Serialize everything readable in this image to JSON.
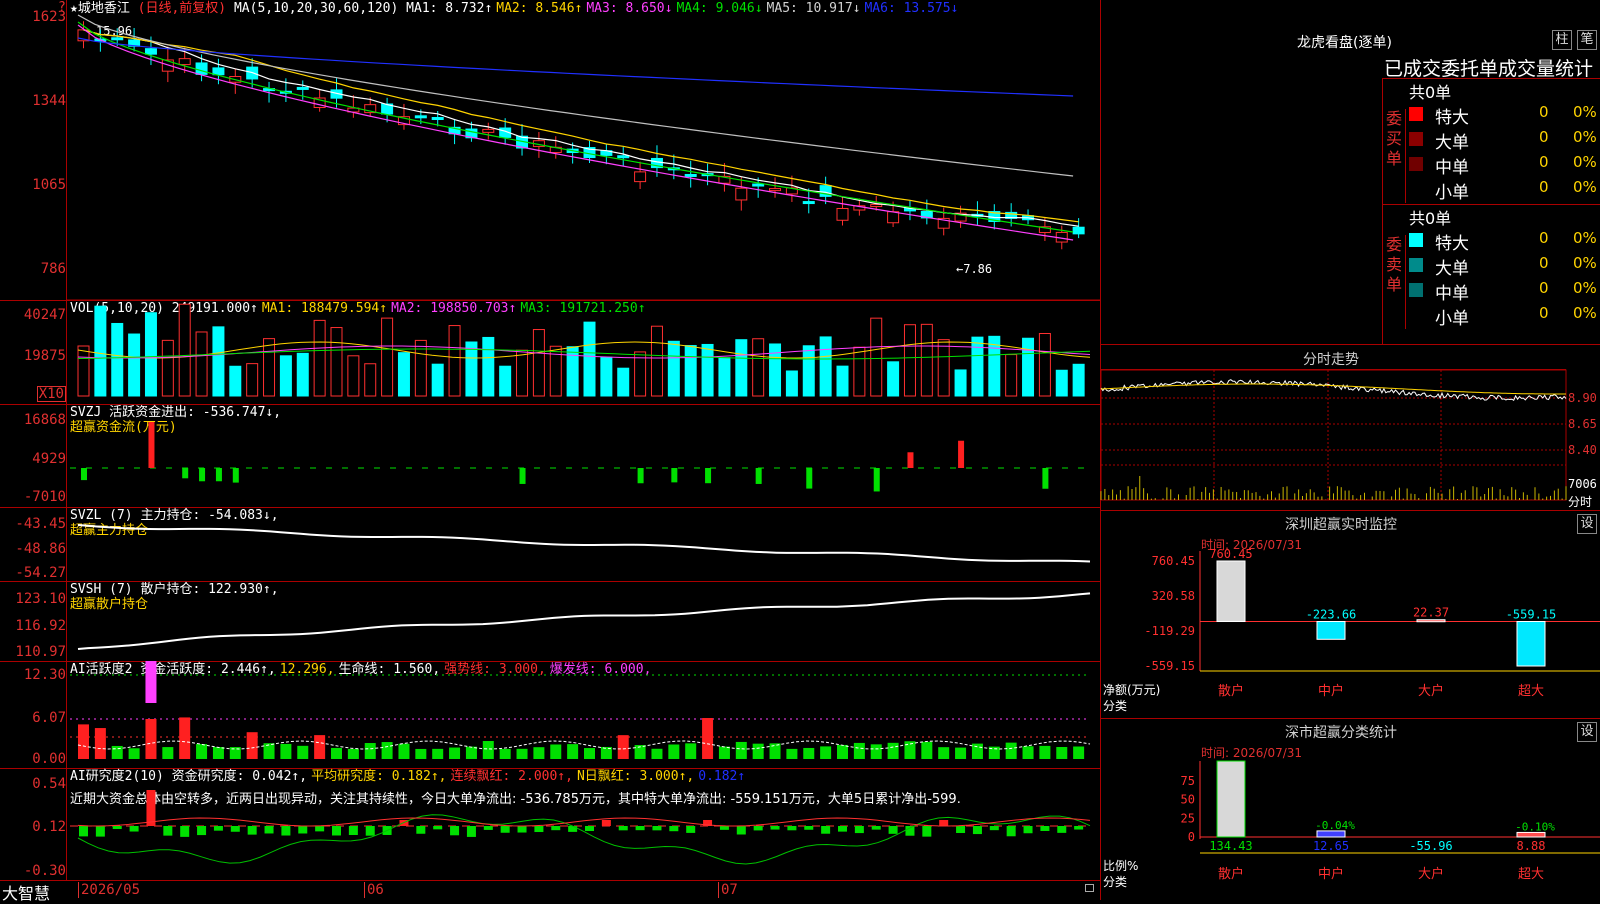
{
  "stock": {
    "title": "★城地香江",
    "mode": "(日线,前复权)",
    "ma_label": "MA(5,10,20,30,60,120)",
    "ma": [
      {
        "text": "MA1: 8.732↑",
        "color": "#ffffff"
      },
      {
        "text": "MA2: 8.546↑",
        "color": "#ffd400"
      },
      {
        "text": "MA3: 8.650↓",
        "color": "#ff40ff"
      },
      {
        "text": "MA4: 9.046↓",
        "color": "#00e000"
      },
      {
        "text": "MA5: 10.917↓",
        "color": "#d0d0d0"
      },
      {
        "text": "MA6: 13.575↓",
        "color": "#2030ff"
      }
    ],
    "high_note": "15.96",
    "low_note": "←7.86",
    "yaxis": [
      "1623",
      "1344",
      "1065",
      "786"
    ]
  },
  "vol": {
    "label": "VOL(5,10,20)",
    "items": [
      {
        "text": "249191.000↑",
        "color": "#ffffff"
      },
      {
        "text": "MA1: 188479.594↑",
        "color": "#ffd400"
      },
      {
        "text": "MA2: 198850.703↑",
        "color": "#ff40ff"
      },
      {
        "text": "MA3: 191721.250↑",
        "color": "#00e000"
      }
    ],
    "yaxis": [
      "40247",
      "19875"
    ],
    "unit": "X10"
  },
  "svzj": {
    "label": "SVZJ  活跃资金进出: -536.747↓,",
    "sub": "超赢资金流(万元)",
    "yaxis": [
      "16868",
      "4929",
      "-7010"
    ]
  },
  "svzl": {
    "label": "SVZL (7) 主力持仓: -54.083↓,",
    "sub": "超赢主力持仓",
    "yaxis": [
      "-43.45",
      "-48.86",
      "-54.27"
    ]
  },
  "svsh": {
    "label": "SVSH (7) 散户持仓: 122.930↑,",
    "sub": "超赢散户持仓",
    "yaxis": [
      "123.10",
      "116.92",
      "110.97"
    ]
  },
  "ai1": {
    "items": [
      {
        "text": "AI活跃度2 资金活跃度: 2.446↑,",
        "color": "#ffffff"
      },
      {
        "text": "12.296,",
        "color": "#ffd400"
      },
      {
        "text": "生命线: 1.560,",
        "color": "#ffffff"
      },
      {
        "text": "强势线: 3.000,",
        "color": "#ff3030"
      },
      {
        "text": "爆发线: 6.000,",
        "color": "#ff40ff"
      }
    ],
    "yaxis": [
      "12.30",
      "6.07",
      "0.00"
    ]
  },
  "ai2": {
    "items": [
      {
        "text": "AI研究度2(10) 资金研究度: 0.042↑,",
        "color": "#ffffff"
      },
      {
        "text": "平均研究度: 0.182↑,",
        "color": "#ffd400"
      },
      {
        "text": "连续飘红: 2.000↑,",
        "color": "#ff3030"
      },
      {
        "text": "N日飘红: 3.000↑,",
        "color": "#ffd400"
      },
      {
        "text": "0.182↑",
        "color": "#2030ff"
      }
    ],
    "note": "近期大资金总体由空转多，近两日出现异动，关注其持续性，今日大单净流出: -536.785万元，其中特大单净流出: -559.151万元，大单5日累计净出-599.",
    "yaxis": [
      "0.54",
      "0.12",
      "-0.30"
    ]
  },
  "xaxis": {
    "d1": "2026/05",
    "d2": "06",
    "d3": "07"
  },
  "brand": "大智慧",
  "lhb": {
    "title": "龙虎看盘(逐单)",
    "btn1": "柱",
    "btn2": "笔",
    "headline": "已成交委托单成交量统计",
    "buy": {
      "count": "共0单",
      "side": "委买单",
      "rows": [
        {
          "label": "特大",
          "v": "0",
          "p": "0%",
          "color": "#ff0000"
        },
        {
          "label": "大单",
          "v": "0",
          "p": "0%",
          "color": "#8b0000"
        },
        {
          "label": "中单",
          "v": "0",
          "p": "0%",
          "color": "#700000"
        },
        {
          "label": "小单",
          "v": "0",
          "p": "0%",
          "color": ""
        }
      ]
    },
    "sell": {
      "count": "共0单",
      "side": "委卖单",
      "rows": [
        {
          "label": "特大",
          "v": "0",
          "p": "0%",
          "color": "#00ffff"
        },
        {
          "label": "大单",
          "v": "0",
          "p": "0%",
          "color": "#008b8b"
        },
        {
          "label": "中单",
          "v": "0",
          "p": "0%",
          "color": "#007070"
        },
        {
          "label": "小单",
          "v": "0",
          "p": "0%",
          "color": ""
        }
      ]
    }
  },
  "fenshi": {
    "title": "分时走势",
    "yaxis": [
      "8.90",
      "8.65",
      "8.40"
    ],
    "vol": "7006",
    "unit": "分时"
  },
  "monitor": {
    "title": "深圳超赢实时监控",
    "btn": "设",
    "time": "时间: 2026/07/31",
    "yaxis": [
      "760.45",
      "320.58",
      "-119.29",
      "-559.15"
    ],
    "ylabel": "净额(万元)",
    "xlabel": "分类",
    "bars": [
      {
        "cat": "散户",
        "value": 760.45,
        "label": "760.45"
      },
      {
        "cat": "中户",
        "value": -223.66,
        "label": "-223.66"
      },
      {
        "cat": "大户",
        "value": 22.37,
        "label": "22.37"
      },
      {
        "cat": "超大",
        "value": -559.15,
        "label": "-559.15"
      }
    ]
  },
  "classify": {
    "title": "深市超赢分类统计",
    "btn": "设",
    "time": "时间: 2026/07/31",
    "yaxis": [
      "75",
      "50",
      "25",
      "0"
    ],
    "ylabel": "比例%",
    "xlabel": "分类",
    "bars": [
      {
        "cat": "散户",
        "pct": 100,
        "label": "134.43"
      },
      {
        "cat": "中户",
        "pct": 8,
        "label": "12.65",
        "note": "-0.04%"
      },
      {
        "cat": "大户",
        "pct": 0,
        "label": "-55.96"
      },
      {
        "cat": "超大",
        "pct": 6,
        "label": "8.88",
        "note": "-0.10%"
      }
    ]
  }
}
